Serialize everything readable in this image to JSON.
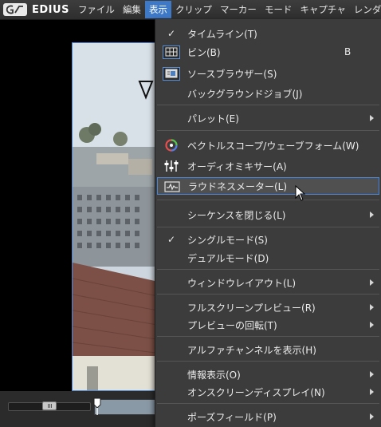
{
  "menubar": {
    "app_name": "EDIUS",
    "items": [
      "ファイル",
      "編集",
      "表示",
      "クリップ",
      "マーカー",
      "モード",
      "キャプチャ",
      "レンダリング"
    ],
    "active_index": 2
  },
  "view_menu": {
    "items": [
      {
        "label": "タイムライン(T)",
        "checked": true,
        "icon": null,
        "shortcut": "",
        "submenu": false
      },
      {
        "label": "ビン(B)",
        "checked": false,
        "icon": "bin-icon",
        "shortcut": "B",
        "submenu": false
      },
      {
        "label": "ソースブラウザー(S)",
        "checked": false,
        "icon": "source-browser-icon",
        "shortcut": "",
        "submenu": false
      },
      {
        "label": "バックグラウンドジョブ(J)",
        "checked": false,
        "icon": null,
        "shortcut": "",
        "submenu": false
      },
      {
        "label": "パレット(E)",
        "checked": false,
        "icon": null,
        "shortcut": "",
        "submenu": true
      },
      {
        "label": "ベクトルスコープ/ウェーブフォーム(W)",
        "checked": false,
        "icon": "vectorscope-icon",
        "shortcut": "",
        "submenu": false
      },
      {
        "label": "オーディオミキサー(A)",
        "checked": false,
        "icon": "audio-mixer-icon",
        "shortcut": "",
        "submenu": false
      },
      {
        "label": "ラウドネスメーター(L)",
        "checked": false,
        "icon": "loudness-meter-icon",
        "shortcut": "",
        "submenu": false,
        "hover": true
      },
      {
        "label": "シーケンスを閉じる(L)",
        "checked": false,
        "icon": null,
        "shortcut": "",
        "submenu": true
      },
      {
        "label": "シングルモード(S)",
        "checked": true,
        "icon": null,
        "shortcut": "",
        "submenu": false
      },
      {
        "label": "デュアルモード(D)",
        "checked": false,
        "icon": null,
        "shortcut": "",
        "submenu": false
      },
      {
        "label": "ウィンドウレイアウト(L)",
        "checked": false,
        "icon": null,
        "shortcut": "",
        "submenu": true
      },
      {
        "label": "フルスクリーンプレビュー(R)",
        "checked": false,
        "icon": null,
        "shortcut": "",
        "submenu": true
      },
      {
        "label": "プレビューの回転(T)",
        "checked": false,
        "icon": null,
        "shortcut": "",
        "submenu": true
      },
      {
        "label": "アルファチャンネルを表示(H)",
        "checked": false,
        "icon": null,
        "shortcut": "",
        "submenu": false
      },
      {
        "label": "情報表示(O)",
        "checked": false,
        "icon": null,
        "shortcut": "",
        "submenu": true
      },
      {
        "label": "オンスクリーンディスプレイ(N)",
        "checked": false,
        "icon": null,
        "shortcut": "",
        "submenu": true
      },
      {
        "label": "ポーズフィールド(P)",
        "checked": false,
        "icon": null,
        "shortcut": "",
        "submenu": true
      }
    ]
  },
  "colors": {
    "accent": "#3e79c8",
    "menu_bg": "#3c3c3c",
    "highlight_border": "#4a86d8"
  }
}
